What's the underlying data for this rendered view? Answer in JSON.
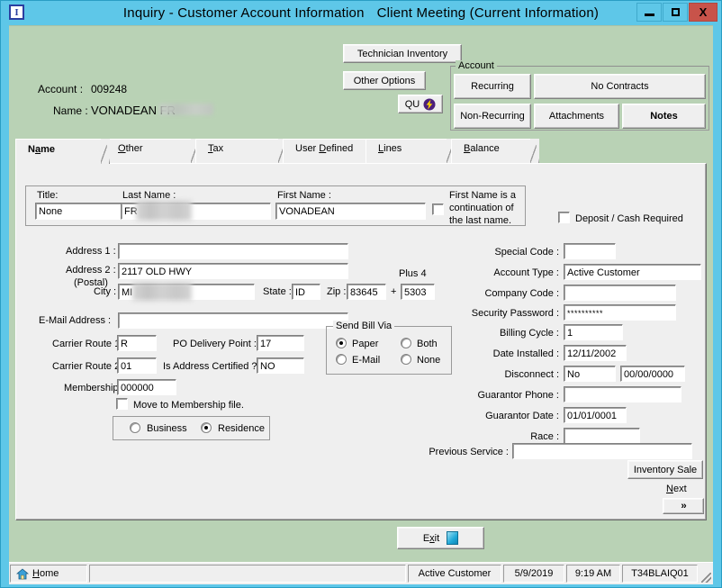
{
  "window": {
    "app_icon": "app-i-icon",
    "title_main": "Inquiry - Customer Account Information",
    "title_sub": "Client Meeting  (Current Information)",
    "minimize_label": "minimize-icon",
    "maximize_label": "maximize-icon",
    "close_label": "X",
    "titlebar_color": "#5ec7e8",
    "client_color": "#b9d2b5",
    "close_color": "#c8534a"
  },
  "header": {
    "account_label": "Account :",
    "account_value": "009248",
    "name_label": "Name :",
    "name_value": "VONADEAN FR",
    "technician_inventory": "Technician Inventory",
    "other_options": "Other Options",
    "qu_button": "QU"
  },
  "account_group": {
    "legend": "Account",
    "buttons": [
      {
        "label": "Recurring"
      },
      {
        "label": "No Contracts"
      },
      {
        "label": "Non-Recurring"
      },
      {
        "label": "Attachments"
      },
      {
        "label": "Notes"
      }
    ]
  },
  "tabs": [
    {
      "label": "Name",
      "pre": "N",
      "acc": "a",
      "post": "me",
      "active": true
    },
    {
      "label": "Other",
      "pre": "",
      "acc": "O",
      "post": "ther",
      "active": false
    },
    {
      "label": "Tax",
      "pre": "",
      "acc": "T",
      "post": "ax",
      "active": false
    },
    {
      "label": "User Defined",
      "pre": "User ",
      "acc": "D",
      "post": "efined",
      "active": false
    },
    {
      "label": "Lines",
      "pre": "",
      "acc": "L",
      "post": "ines",
      "active": false
    },
    {
      "label": "Balance",
      "pre": "",
      "acc": "B",
      "post": "alance",
      "active": false
    }
  ],
  "name_group": {
    "title_label": "Title:",
    "title_value": "None",
    "last_name_label": "Last Name :",
    "last_name_value": "FR",
    "first_name_label": "First Name :",
    "first_name_value": "VONADEAN",
    "continuation_label_line1": "First Name is a",
    "continuation_label_line2": "continuation of",
    "continuation_label_line3": "the last name.",
    "continuation_checked": false
  },
  "left_form": {
    "address1_label": "Address 1 :",
    "address1_value": "",
    "address2_label": "Address 2 :",
    "address2_sub_label": "(Postal)",
    "address2_value": "2117 OLD HWY",
    "city_label": "City :",
    "city_value": "MI",
    "state_label": "State :",
    "state_value": "ID",
    "zip_label": "Zip :",
    "zip_value": "83645",
    "plus_sign": "+",
    "plus4_label": "Plus 4",
    "plus4_value": "5303",
    "email_label": "E-Mail Address :",
    "email_value": "",
    "carrier_route1_label": "Carrier Route 1 :",
    "carrier_route1_value": "R",
    "po_delivery_label": "PO Delivery Point :",
    "po_delivery_value": "17",
    "carrier_route2_label": "Carrier Route 2 :",
    "carrier_route2_value": "01",
    "address_certified_label": "Is Address Certified ?",
    "address_certified_value": "NO",
    "membership_label": "Membership :",
    "membership_value": "000000",
    "move_membership_label": "Move to Membership file.",
    "move_membership_checked": false
  },
  "send_bill_via": {
    "legend": "Send Bill Via",
    "options": [
      {
        "label": "Paper",
        "selected": true
      },
      {
        "label": "Both",
        "selected": false
      },
      {
        "label": "E-Mail",
        "selected": false
      },
      {
        "label": "None",
        "selected": false
      }
    ]
  },
  "business_residence": {
    "options": [
      {
        "label": "Business",
        "selected": false
      },
      {
        "label": "Residence",
        "selected": true
      }
    ]
  },
  "right_form": {
    "deposit_label": "Deposit / Cash Required",
    "deposit_checked": false,
    "special_code_label": "Special Code :",
    "special_code_value": "",
    "account_type_label": "Account Type :",
    "account_type_value": "Active Customer",
    "company_code_label": "Company Code :",
    "company_code_value": "",
    "security_password_label": "Security Password :",
    "security_password_value": "**********",
    "billing_cycle_label": "Billing Cycle :",
    "billing_cycle_value": "1",
    "date_installed_label": "Date Installed :",
    "date_installed_value": "12/11/2002",
    "disconnect_label": "Disconnect :",
    "disconnect_value": "No",
    "disconnect_date_value": "00/00/0000",
    "guarantor_phone_label": "Guarantor Phone :",
    "guarantor_phone_value": "",
    "guarantor_date_label": "Guarantor Date :",
    "guarantor_date_value": "01/01/0001",
    "race_label": "Race :",
    "race_value": "",
    "previous_service_label": "Previous Service :",
    "previous_service_value": "",
    "inventory_sale_button": "Inventory Sale",
    "next_label": "Next",
    "next_button": "»"
  },
  "footer": {
    "exit_label": "Exit"
  },
  "statusbar": {
    "home_label": "Home",
    "blank": "",
    "status": "Active Customer",
    "date": "5/9/2019",
    "time": "9:19 AM",
    "terminal": "T34BLAIQ01"
  }
}
